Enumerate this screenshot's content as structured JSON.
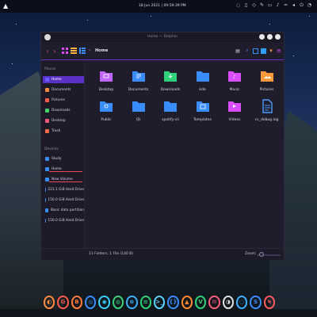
{
  "topbar": {
    "clock": "18 Jun 2021 | 09:59:39 PM",
    "tray_icons": [
      "chat-icon",
      "clipboard-icon",
      "dropbox-icon",
      "pencil-icon",
      "terminal-icon",
      "bell-icon",
      "wifi-icon",
      "volume-icon",
      "power-icon",
      "notification-icon"
    ]
  },
  "window": {
    "title": "Home — Dolphin",
    "breadcrumb": "Home"
  },
  "sidebar": {
    "places_title": "Places",
    "places": [
      {
        "label": "Home",
        "active": true,
        "color": "#6b5cff"
      },
      {
        "label": "Documents",
        "active": false,
        "color": "#ff8a3d"
      },
      {
        "label": "Pictures",
        "active": false,
        "color": "#ff5a4a"
      },
      {
        "label": "Downloads",
        "active": false,
        "color": "#3fd36a"
      },
      {
        "label": "Desktop",
        "active": false,
        "color": "#ff5a7a"
      },
      {
        "label": "Trash",
        "active": false,
        "color": "#ff6a4a"
      }
    ],
    "devices_title": "Devices",
    "devices": [
      {
        "label": "Study",
        "color": "#3a8dff"
      },
      {
        "label": "Home",
        "color": "#3a8dff"
      },
      {
        "label": "New Volume",
        "color": "#3a8dff"
      },
      {
        "label": "223.1 GiB Hard Drive",
        "color": "#3a8dff"
      },
      {
        "label": "150.0 GiB Hard Drive",
        "color": "#3a8dff"
      },
      {
        "label": "Basic data partition",
        "color": "#3a8dff"
      },
      {
        "label": "150.0 GiB Hard Drive",
        "color": "#3a8dff"
      }
    ]
  },
  "files": [
    {
      "name": "Desktop",
      "icon": "desktop-folder-icon",
      "color": "#c066ff"
    },
    {
      "name": "Documents",
      "icon": "documents-folder-icon",
      "color": "#3a8dff"
    },
    {
      "name": "Downloads",
      "icon": "downloads-folder-icon",
      "color": "#2fd07a"
    },
    {
      "name": "kde",
      "icon": "folder-icon",
      "color": "#3a8dff"
    },
    {
      "name": "Music",
      "icon": "music-folder-icon",
      "color": "#d94cff"
    },
    {
      "name": "Pictures",
      "icon": "pictures-folder-icon",
      "color": "#ff9a3d"
    },
    {
      "name": "Public",
      "icon": "public-folder-icon",
      "color": "#3a8dff"
    },
    {
      "name": "Qt",
      "icon": "folder-icon",
      "color": "#3a8dff"
    },
    {
      "name": "spotify-cli",
      "icon": "folder-icon",
      "color": "#3a8dff"
    },
    {
      "name": "Templates",
      "icon": "templates-folder-icon",
      "color": "#3a8dff"
    },
    {
      "name": "Videos",
      "icon": "videos-folder-icon",
      "color": "#d94cff"
    },
    {
      "name": "cv_debug.log",
      "icon": "text-file-icon",
      "color": "#4a9dff"
    }
  ],
  "status": {
    "summary": "11 Folders, 1 File (140 B)",
    "zoom_label": "Zoom:",
    "zoom_level": 0.2
  },
  "dock": [
    {
      "name": "launcher-icon",
      "glyph": "◐",
      "color": "#ff8a3d"
    },
    {
      "name": "git-icon",
      "glyph": "G",
      "color": "#ff5a4a"
    },
    {
      "name": "brave-icon",
      "glyph": "B",
      "color": "#ff7a3d"
    },
    {
      "name": "app-blue-icon",
      "glyph": "◎",
      "color": "#3a8dff"
    },
    {
      "name": "app-ring-icon",
      "glyph": "◉",
      "color": "#3acfff"
    },
    {
      "name": "chrome-icon",
      "glyph": "◍",
      "color": "#3ad07a"
    },
    {
      "name": "app-orbit-icon",
      "glyph": "⊛",
      "color": "#3ab0ff"
    },
    {
      "name": "spotify-icon",
      "glyph": "≋",
      "color": "#2fd07a"
    },
    {
      "name": "terminal-icon",
      "glyph": ">_",
      "color": "#5ad0ff"
    },
    {
      "name": "code-icon",
      "glyph": "{}",
      "color": "#3a8dff"
    },
    {
      "name": "vlc-icon",
      "glyph": "▲",
      "color": "#ff8a2d"
    },
    {
      "name": "vim-icon",
      "glyph": "V",
      "color": "#2fd07a"
    },
    {
      "name": "mail-icon",
      "glyph": "✉",
      "color": "#ff5a7a"
    },
    {
      "name": "app-globe-icon",
      "glyph": "◑",
      "color": "#e0e0e0"
    },
    {
      "name": "app-ring2-icon",
      "glyph": "◌",
      "color": "#3ab0ff"
    },
    {
      "name": "skype-icon",
      "glyph": "S",
      "color": "#3a8dff"
    },
    {
      "name": "app-bolt-icon",
      "glyph": "Ϟ",
      "color": "#ff5a5a"
    }
  ]
}
